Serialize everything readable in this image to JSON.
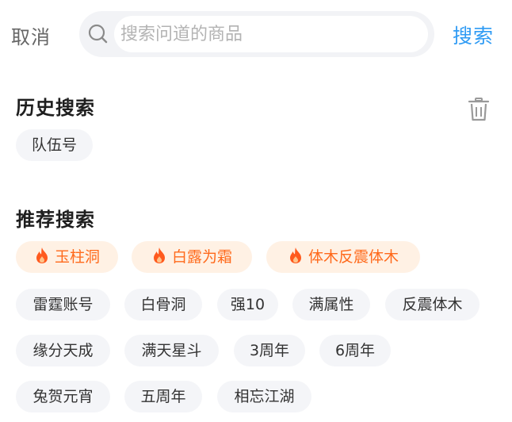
{
  "header": {
    "cancel_label": "取消",
    "search_placeholder": "搜索问道的商品",
    "search_value": "",
    "search_button_label": "搜索"
  },
  "history": {
    "title": "历史搜索",
    "items": [
      "队伍号"
    ]
  },
  "recommend": {
    "title": "推荐搜索",
    "hot_items": [
      "玉柱洞",
      "白露为霜",
      "体木反震体木"
    ],
    "items": [
      "雷霆账号",
      "白骨洞",
      "强10",
      "满属性",
      "反震体木",
      "缘分天成",
      "满天星斗",
      "3周年",
      "6周年",
      "兔贺元宵",
      "五周年",
      "相忘江湖"
    ]
  },
  "colors": {
    "accent": "#2f9bf4",
    "hot_text": "#ff6a1c",
    "hot_bg": "#fff1e4",
    "chip_bg": "#f4f5f8"
  }
}
